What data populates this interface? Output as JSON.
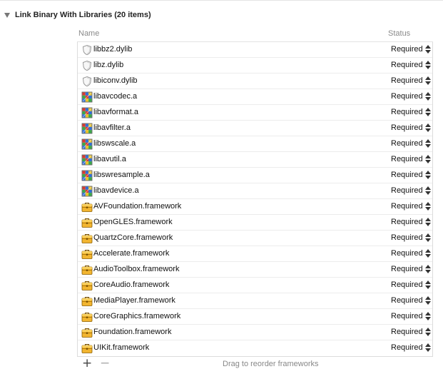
{
  "phase": {
    "title": "Link Binary With Libraries (20 items)"
  },
  "columns": {
    "name": "Name",
    "status": "Status"
  },
  "items": [
    {
      "name": "libbz2.dylib",
      "status": "Required",
      "kind": "dylib"
    },
    {
      "name": "libz.dylib",
      "status": "Required",
      "kind": "dylib"
    },
    {
      "name": "libiconv.dylib",
      "status": "Required",
      "kind": "dylib"
    },
    {
      "name": "libavcodec.a",
      "status": "Required",
      "kind": "static"
    },
    {
      "name": "libavformat.a",
      "status": "Required",
      "kind": "static"
    },
    {
      "name": "libavfilter.a",
      "status": "Required",
      "kind": "static"
    },
    {
      "name": "libswscale.a",
      "status": "Required",
      "kind": "static"
    },
    {
      "name": "libavutil.a",
      "status": "Required",
      "kind": "static"
    },
    {
      "name": "libswresample.a",
      "status": "Required",
      "kind": "static"
    },
    {
      "name": "libavdevice.a",
      "status": "Required",
      "kind": "static"
    },
    {
      "name": "AVFoundation.framework",
      "status": "Required",
      "kind": "framework"
    },
    {
      "name": "OpenGLES.framework",
      "status": "Required",
      "kind": "framework"
    },
    {
      "name": "QuartzCore.framework",
      "status": "Required",
      "kind": "framework"
    },
    {
      "name": "Accelerate.framework",
      "status": "Required",
      "kind": "framework"
    },
    {
      "name": "AudioToolbox.framework",
      "status": "Required",
      "kind": "framework"
    },
    {
      "name": "CoreAudio.framework",
      "status": "Required",
      "kind": "framework"
    },
    {
      "name": "MediaPlayer.framework",
      "status": "Required",
      "kind": "framework"
    },
    {
      "name": "CoreGraphics.framework",
      "status": "Required",
      "kind": "framework"
    },
    {
      "name": "Foundation.framework",
      "status": "Required",
      "kind": "framework"
    },
    {
      "name": "UIKit.framework",
      "status": "Required",
      "kind": "framework"
    }
  ],
  "icons": {
    "dylib": "shield-icon",
    "static": "static-library-icon",
    "framework": "framework-toolbox-icon"
  },
  "footer": {
    "add": "+",
    "remove": "−",
    "hint": "Drag to reorder frameworks"
  }
}
